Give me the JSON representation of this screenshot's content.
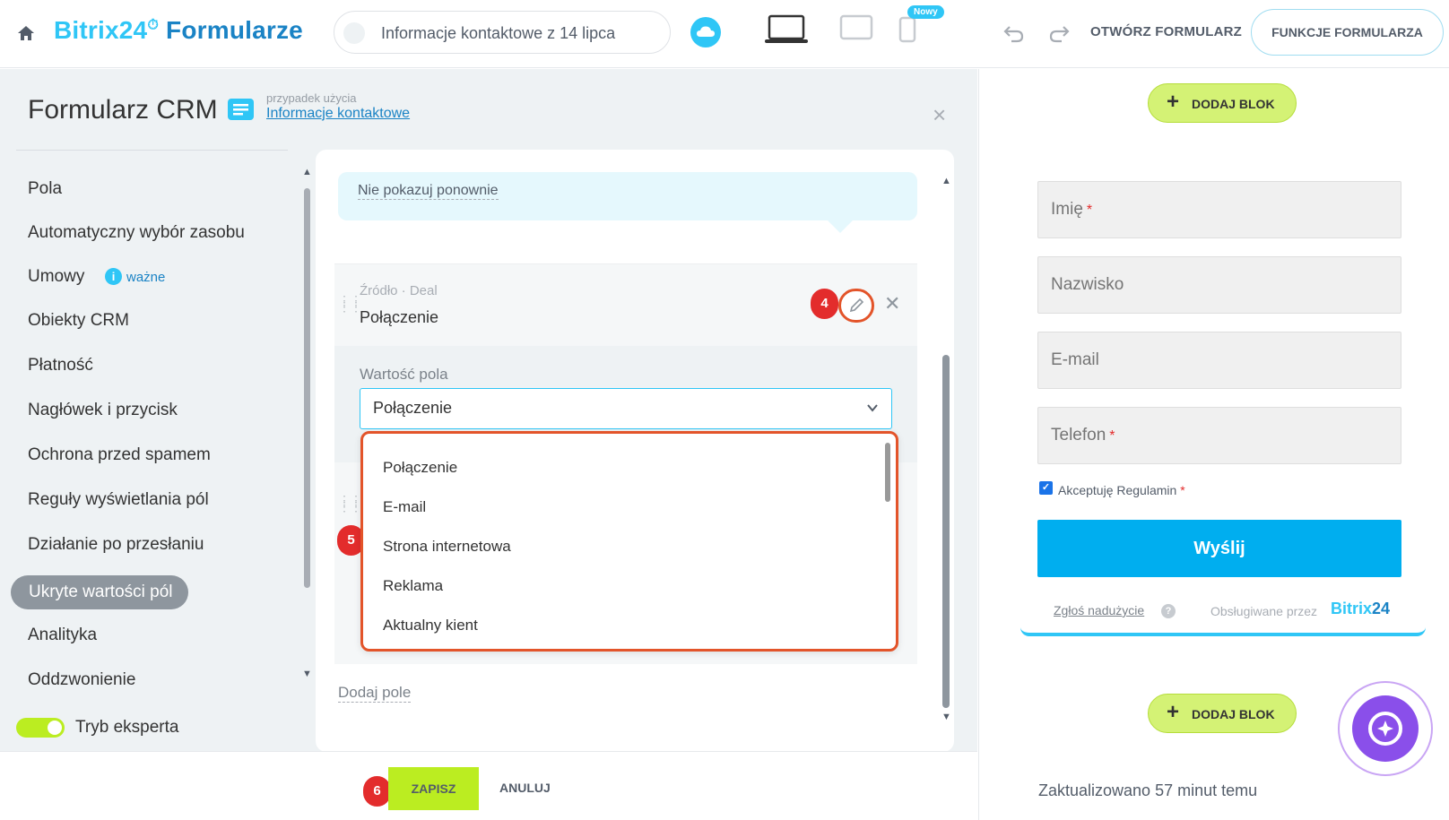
{
  "header": {
    "brand_part1": "Bitrix24",
    "brand_clock": "⏱",
    "brand_part2": "Formularze",
    "form_name": "Informacje kontaktowe z 14 lipca",
    "badge_new": "Nowy",
    "open_form": "OTWÓRZ FORMULARZ",
    "form_functions": "FUNKCJE FORMULARZA"
  },
  "sidebar": {
    "title": "Formularz CRM",
    "use_case_small": "przypadek użycia",
    "use_case_link": "Informacje kontaktowe",
    "items": [
      {
        "label": "Pola"
      },
      {
        "label": "Automatyczny wybór zasobu"
      },
      {
        "label": "Umowy"
      },
      {
        "label": "Obiekty CRM"
      },
      {
        "label": "Płatność"
      },
      {
        "label": "Nagłówek i przycisk"
      },
      {
        "label": "Ochrona przed spamem"
      },
      {
        "label": "Reguły wyświetlania pól"
      },
      {
        "label": "Działanie po przesłaniu"
      },
      {
        "label": "Ukryte wartości pól"
      },
      {
        "label": "Analityka"
      },
      {
        "label": "Oddzwonienie"
      }
    ],
    "important_label": "ważne",
    "info_glyph": "i",
    "expert_mode": "Tryb eksperta"
  },
  "editor": {
    "dont_show_again": "Nie pokazuj ponownie",
    "field_source": "Źródło · Deal",
    "field_name": "Połączenie",
    "field_value_label": "Wartość pola",
    "selected_value": "Połączenie",
    "options": [
      "Połączenie",
      "E-mail",
      "Strona internetowa",
      "Reklama",
      "Aktualny kient"
    ],
    "add_field": "Dodaj pole",
    "steps": [
      "4",
      "5",
      "6"
    ]
  },
  "footer": {
    "save": "ZAPISZ",
    "cancel": "ANULUJ"
  },
  "preview": {
    "add_block": "DODAJ BLOK",
    "fields": [
      {
        "label": "Imię",
        "required": "*"
      },
      {
        "label": "Nazwisko",
        "required": ""
      },
      {
        "label": "E-mail",
        "required": ""
      },
      {
        "label": "Telefon",
        "required": "*"
      }
    ],
    "accept_terms": "Akceptuję Regulamin",
    "accept_required": "*",
    "terms_checked": true,
    "submit": "Wyślij",
    "report_abuse": "Zgłoś nadużycie",
    "help_glyph": "?",
    "powered_by": "Obsługiwane przez",
    "powered_brand_a": "Bitrix",
    "powered_brand_b": "24",
    "updated": "Zaktualizowano 57 minut temu"
  },
  "colors": {
    "accent": "#2fc6f6",
    "brand_dark": "#1a83c5",
    "highlight": "#e3542a",
    "step_badge": "#e32c2c",
    "save_green": "#bbed21",
    "submit_blue": "#00aeef"
  }
}
